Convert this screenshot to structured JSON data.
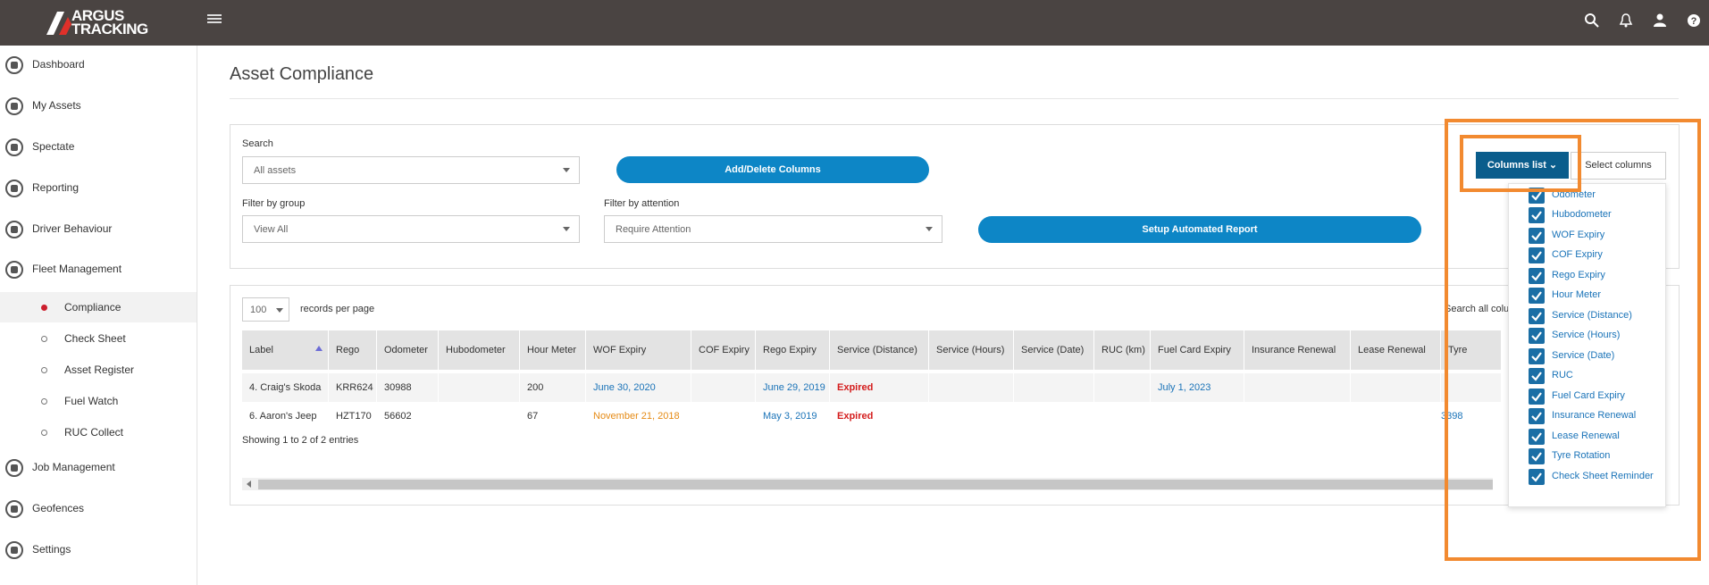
{
  "brand": {
    "line1": "ARGUS",
    "line2": "TRACKING"
  },
  "sidebar": {
    "items": [
      {
        "label": "Dashboard",
        "icon": "gauge-icon"
      },
      {
        "label": "My Assets",
        "icon": "assets-icon"
      },
      {
        "label": "Spectate",
        "icon": "location-pin-icon"
      },
      {
        "label": "Reporting",
        "icon": "report-icon"
      },
      {
        "label": "Driver Behaviour",
        "icon": "lightbulb-icon"
      },
      {
        "label": "Fleet Management",
        "icon": "truck-icon"
      }
    ],
    "sub_items": [
      {
        "label": "Compliance",
        "active": true
      },
      {
        "label": "Check Sheet",
        "active": false
      },
      {
        "label": "Asset Register",
        "active": false
      },
      {
        "label": "Fuel Watch",
        "active": false
      },
      {
        "label": "RUC Collect",
        "active": false
      }
    ],
    "bottom_items": [
      {
        "label": "Job Management",
        "icon": "briefcase-icon"
      },
      {
        "label": "Geofences",
        "icon": "geofence-icon"
      },
      {
        "label": "Settings",
        "icon": "gear-icon"
      }
    ]
  },
  "page": {
    "title": "Asset Compliance"
  },
  "filters": {
    "search_label": "Search",
    "search_value": "All assets",
    "add_delete_label": "Add/Delete Columns",
    "group_label": "Filter by group",
    "group_value": "View All",
    "attention_label": "Filter by attention",
    "attention_value": "Require Attention",
    "setup_report_label": "Setup Automated Report",
    "columns_list_label": "Columns list ⌄",
    "select_columns_label": "Select columns"
  },
  "columns_dropdown": [
    "Odometer",
    "Hubodometer",
    "WOF Expiry",
    "COF Expiry",
    "Rego Expiry",
    "Hour Meter",
    "Service (Distance)",
    "Service (Hours)",
    "Service (Date)",
    "RUC",
    "Fuel Card Expiry",
    "Insurance Renewal",
    "Lease Renewal",
    "Tyre Rotation",
    "Check Sheet Reminder"
  ],
  "table": {
    "page_size": "100",
    "records_per_page": "records per page",
    "search_all_cols": "Search all colu",
    "headers": [
      "Label",
      "Rego",
      "Odometer",
      "Hubodometer",
      "Hour Meter",
      "WOF Expiry",
      "COF Expiry",
      "Rego Expiry",
      "Service (Distance)",
      "Service (Hours)",
      "Service (Date)",
      "RUC (km)",
      "Fuel Card Expiry",
      "Insurance Renewal",
      "Lease Renewal",
      "Tyre Rotation"
    ],
    "rows": [
      [
        "4. Craig's Skoda",
        "KRR624",
        "30988",
        "",
        "200",
        "June 30, 2020",
        "",
        "June 29, 2019",
        "Expired",
        "",
        "",
        "",
        "July 1, 2023",
        "",
        "",
        ""
      ],
      [
        "6. Aaron's Jeep",
        "HZT170",
        "56602",
        "",
        "67",
        "November 21, 2018",
        "",
        "May 3, 2019",
        "Expired",
        "",
        "",
        "",
        "",
        "",
        "",
        "3398"
      ]
    ],
    "footer": "Showing 1 to 2 of 2 entries"
  },
  "colors": {
    "topbar": "#4a4442",
    "primary": "#0d86c6",
    "highlight": "#f28a30",
    "expired": "#d41c1c"
  }
}
